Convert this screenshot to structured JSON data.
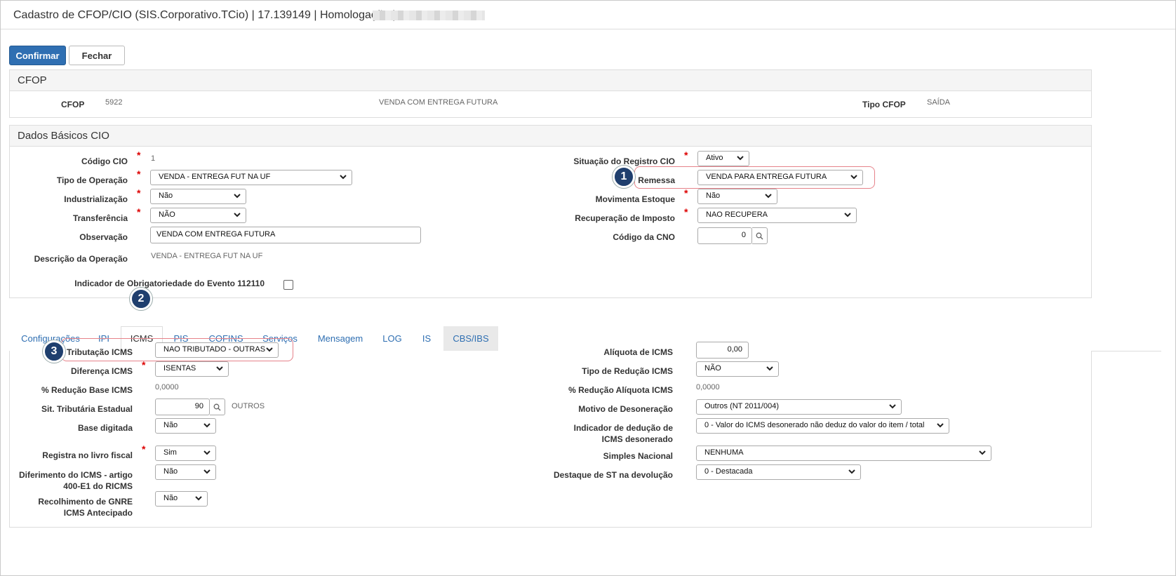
{
  "window": {
    "title": "Cadastro de CFOP/CIO (SIS.Corporativo.TCio) | 17.139149 | Homologação |"
  },
  "toolbar": {
    "confirm_label": "Confirmar",
    "close_label": "Fechar"
  },
  "cfop_panel": {
    "heading": "CFOP",
    "cfop_label": "CFOP",
    "cfop_code": "5922",
    "cfop_description": "VENDA COM ENTREGA FUTURA",
    "tipo_label": "Tipo CFOP",
    "tipo_value": "SAÍDA"
  },
  "basic_panel": {
    "heading": "Dados Básicos CIO",
    "codigo_label": "Código CIO",
    "codigo_value": "1",
    "tipo_operacao_label": "Tipo de Operação",
    "tipo_operacao_value": "VENDA - ENTREGA FUT NA UF",
    "industrializacao_label": "Industrialização",
    "industrializacao_value": "Não",
    "transferencia_label": "Transferência",
    "transferencia_value": "NÃO",
    "observacao_label": "Observação",
    "observacao_value": "VENDA COM ENTREGA FUTURA",
    "descricao_label": "Descrição da Operação",
    "descricao_value": "VENDA - ENTREGA FUT NA UF",
    "indicador_label": "Indicador de Obrigatoriedade do Evento 112110",
    "situacao_label": "Situação do Registro CIO",
    "situacao_value": "Ativo",
    "remessa_label": "Remessa",
    "remessa_value": "VENDA PARA ENTREGA FUTURA",
    "movimenta_label": "Movimenta Estoque",
    "movimenta_value": "Não",
    "recuperacao_label": "Recuperação de Imposto",
    "recuperacao_value": "NAO RECUPERA",
    "cno_label": "Código da CNO",
    "cno_value": "0"
  },
  "tabs": [
    "Configurações",
    "IPI",
    "ICMS",
    "PIS",
    "COFINS",
    "Serviços",
    "Mensagem",
    "LOG",
    "IS",
    "CBS/IBS"
  ],
  "icms": {
    "tributacao_label": "Tributação ICMS",
    "tributacao_value": "NAO TRIBUTADO - OUTRAS",
    "diferenca_label": "Diferença ICMS",
    "diferenca_value": "ISENTAS",
    "reducao_base_label": "% Redução Base ICMS",
    "reducao_base_value": "0,0000",
    "sit_trib_label": "Sit. Tributária Estadual",
    "sit_trib_value": "90",
    "sit_trib_desc": "OUTROS",
    "base_digitada_label": "Base digitada",
    "base_digitada_value": "Não",
    "registra_label": "Registra no livro fiscal",
    "registra_value": "Sim",
    "diferimento_label": "Diferimento do ICMS - artigo 400-E1 do RICMS",
    "diferimento_value": "Não",
    "recolhimento_label": "Recolhimento de GNRE ICMS Antecipado",
    "recolhimento_value": "Não",
    "aliquota_label": "Alíquota de ICMS",
    "aliquota_value": "0,00",
    "tipo_reducao_label": "Tipo de Redução ICMS",
    "tipo_reducao_value": "NÃO",
    "reducao_aliquota_label": "% Redução Alíquota ICMS",
    "reducao_aliquota_value": "0,0000",
    "motivo_label": "Motivo de Desoneração",
    "motivo_value": "Outros (NT 2011/004)",
    "indicador_deducao_label": "Indicador de dedução de ICMS desonerado",
    "indicador_deducao_value": "0 - Valor do ICMS desonerado não deduz do valor do item / total",
    "simples_label": "Simples Nacional",
    "simples_value": "NENHUMA",
    "destaque_label": "Destaque de ST na devolução",
    "destaque_value": "0 - Destacada"
  },
  "callouts": [
    "1",
    "2",
    "3"
  ],
  "colors": {
    "primary": "#2f6fb2",
    "badge": "#1f3f6e",
    "highlight": "#e6828a",
    "required": "#dd0000"
  }
}
